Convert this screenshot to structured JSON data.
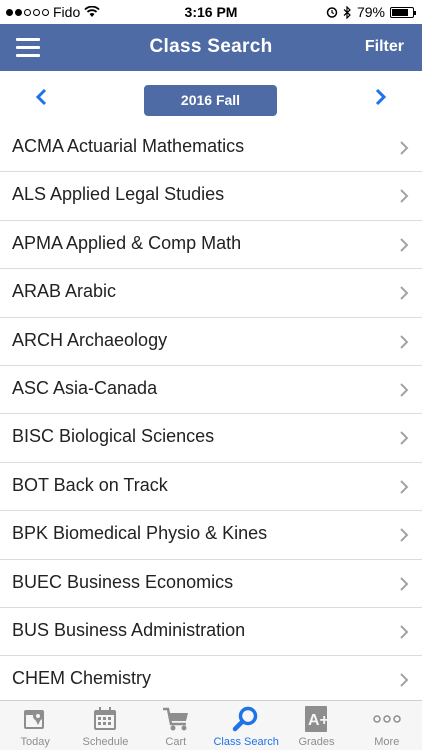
{
  "status_bar": {
    "carrier": "Fido",
    "time": "3:16 PM",
    "battery": "79%",
    "battery_level": 0.79,
    "signal_bars_filled": 2,
    "signal_bars_total": 5
  },
  "header": {
    "title": "Class Search",
    "filter_label": "Filter",
    "background": "#4f6ba5"
  },
  "term": {
    "label": "2016 Fall"
  },
  "subjects": [
    {
      "label": "ACMA Actuarial Mathematics"
    },
    {
      "label": "ALS Applied Legal Studies"
    },
    {
      "label": "APMA Applied & Comp Math"
    },
    {
      "label": "ARAB Arabic"
    },
    {
      "label": "ARCH Archaeology"
    },
    {
      "label": "ASC Asia-Canada"
    },
    {
      "label": "BISC Biological Sciences"
    },
    {
      "label": "BOT Back on Track"
    },
    {
      "label": "BPK Biomedical Physio & Kines"
    },
    {
      "label": "BUEC Business Economics"
    },
    {
      "label": "BUS Business Administration"
    },
    {
      "label": "CHEM Chemistry"
    }
  ],
  "tabs": [
    {
      "label": "Today",
      "icon": "calendar-pin-icon",
      "active": false
    },
    {
      "label": "Schedule",
      "icon": "calendar-icon",
      "active": false
    },
    {
      "label": "Cart",
      "icon": "cart-icon",
      "active": false
    },
    {
      "label": "Class Search",
      "icon": "search-icon",
      "active": true
    },
    {
      "label": "Grades",
      "icon": "grade-a-plus-icon",
      "active": false
    },
    {
      "label": "More",
      "icon": "more-dots-icon",
      "active": false
    }
  ],
  "colors": {
    "accent": "#1e73e8",
    "tab_inactive": "#8e8e8e",
    "nav": "#4f6ba5"
  }
}
